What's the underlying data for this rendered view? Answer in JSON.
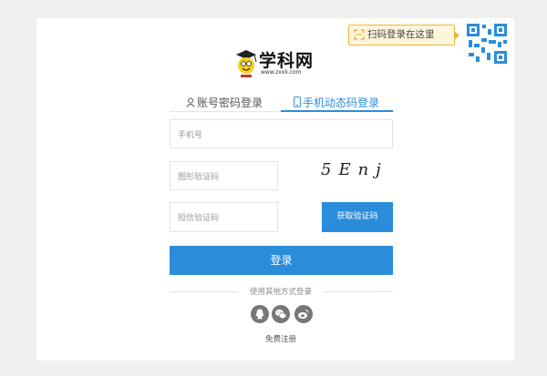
{
  "qr_tip": {
    "text": "扫码登录在这里"
  },
  "logo": {
    "name": "学科网",
    "url_text": "www.zxxk.com"
  },
  "tabs": [
    {
      "label": "账号密码登录"
    },
    {
      "label": "手机动态码登录"
    }
  ],
  "form": {
    "phone_placeholder": "手机号",
    "captcha_placeholder": "图形验证码",
    "captcha_image_text": "5Enj",
    "sms_placeholder": "短信验证码",
    "sms_button": "获取验证码",
    "login_button": "登录"
  },
  "other_login": {
    "label": "使用其他方式登录"
  },
  "register": {
    "label": "免费注册"
  },
  "colors": {
    "accent": "#2a8ddc",
    "tip_bg": "#fff7dc",
    "tip_border": "#f4b43a"
  }
}
